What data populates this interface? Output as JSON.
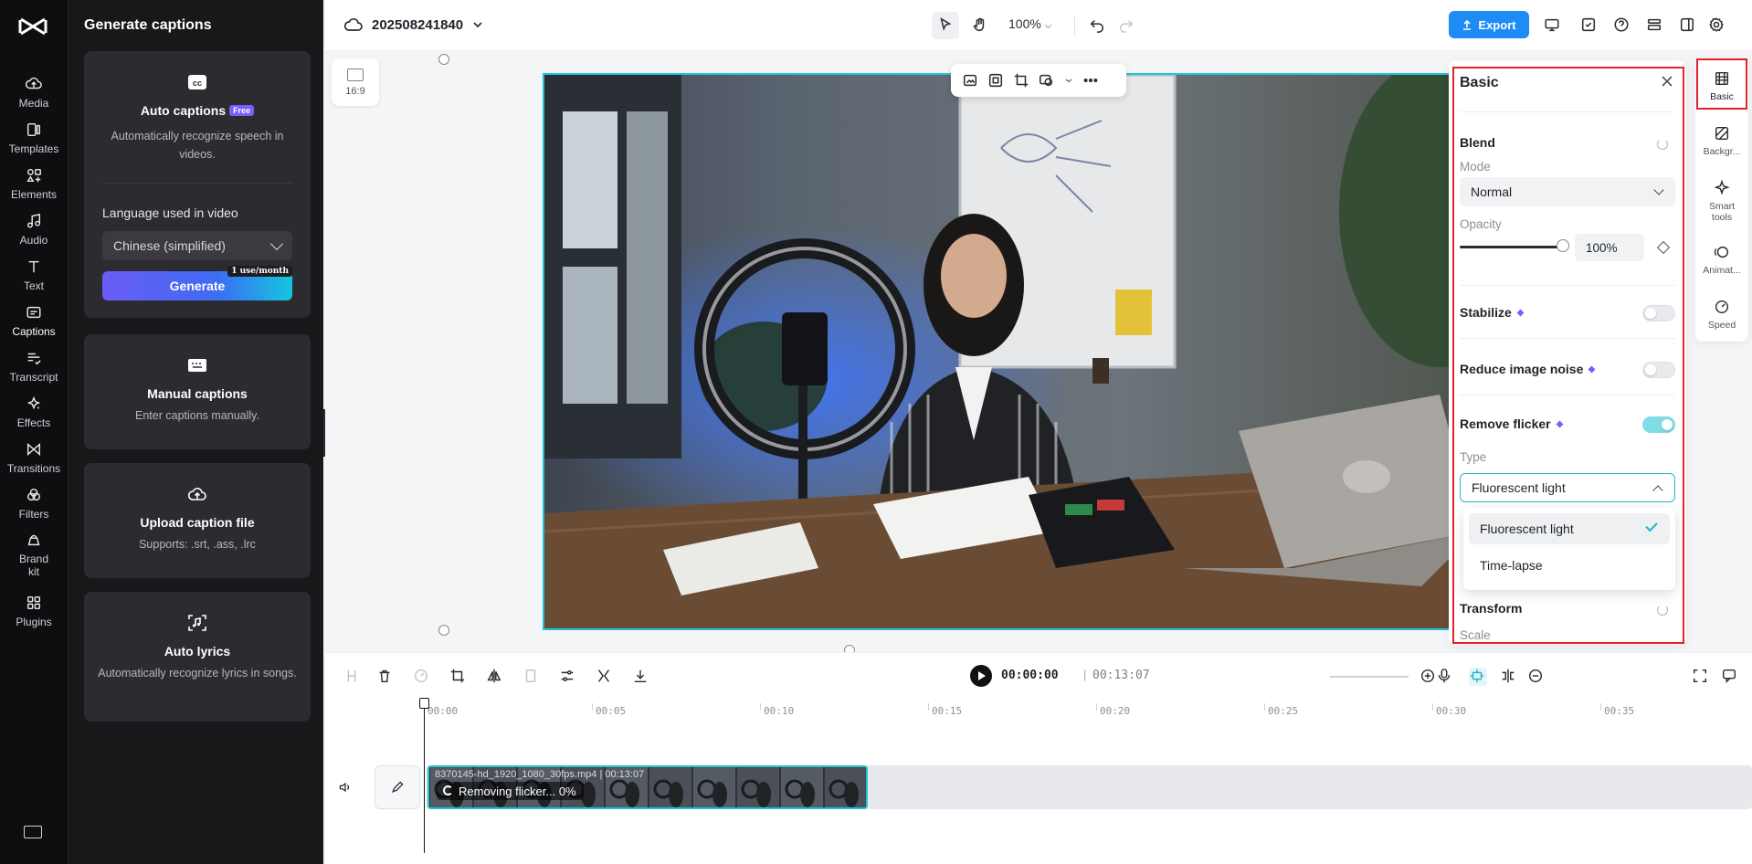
{
  "app": {
    "project_name": "202508241840",
    "zoom": "100%",
    "export_label": "Export"
  },
  "rail": {
    "items": [
      {
        "label": "Media",
        "icon": "cloud-upload-icon"
      },
      {
        "label": "Templates",
        "icon": "templates-icon"
      },
      {
        "label": "Elements",
        "icon": "elements-icon"
      },
      {
        "label": "Audio",
        "icon": "audio-icon"
      },
      {
        "label": "Text",
        "icon": "text-icon"
      },
      {
        "label": "Captions",
        "icon": "captions-icon",
        "active": true
      },
      {
        "label": "Transcript",
        "icon": "transcript-icon"
      },
      {
        "label": "Effects",
        "icon": "effects-icon"
      },
      {
        "label": "Transitions",
        "icon": "transitions-icon"
      },
      {
        "label": "Filters",
        "icon": "filters-icon"
      },
      {
        "label": "Brand kit",
        "icon": "brand-kit-icon"
      },
      {
        "label": "Plugins",
        "icon": "plugins-icon"
      }
    ]
  },
  "captions_panel": {
    "title": "Generate captions",
    "auto": {
      "title": "Auto captions",
      "badge": "Free",
      "desc": "Automatically recognize speech in videos.",
      "lang_label": "Language used in video",
      "lang_value": "Chinese (simplified)",
      "generate_label": "Generate",
      "usage_badge": "1 use/month"
    },
    "manual": {
      "title": "Manual captions",
      "desc": "Enter captions manually."
    },
    "upload": {
      "title": "Upload caption file",
      "desc": "Supports: .srt, .ass, .lrc"
    },
    "lyrics": {
      "title": "Auto lyrics",
      "desc": "Automatically recognize lyrics in songs."
    }
  },
  "canvas": {
    "ratio_label": "16:9"
  },
  "props": {
    "title": "Basic",
    "blend": {
      "title": "Blend",
      "mode_label": "Mode",
      "mode_value": "Normal",
      "opacity_label": "Opacity",
      "opacity_value": "100%",
      "opacity_level": 1.0
    },
    "stabilize": {
      "label": "Stabilize",
      "on": false
    },
    "reduce_noise": {
      "label": "Reduce image noise",
      "on": false
    },
    "remove_flicker": {
      "label": "Remove flicker",
      "on": true,
      "type_label": "Type",
      "type_value": "Fluorescent light",
      "options": [
        {
          "label": "Fluorescent light",
          "selected": true
        },
        {
          "label": "Time-lapse",
          "selected": false
        }
      ]
    },
    "transform": {
      "title": "Transform",
      "scale_label": "Scale"
    }
  },
  "right_tools": [
    {
      "label": "Basic",
      "icon": "basic-icon",
      "active": true
    },
    {
      "label": "Backgr...",
      "icon": "background-icon"
    },
    {
      "label": "Smart tools",
      "icon": "smart-tools-icon"
    },
    {
      "label": "Animat...",
      "icon": "animation-icon"
    },
    {
      "label": "Speed",
      "icon": "speed-icon"
    }
  ],
  "timeline": {
    "current_time": "00:00:00",
    "separator": "|",
    "total_time": "00:13:07",
    "ruler": [
      "00:00",
      "00:05",
      "00:10",
      "00:15",
      "00:20",
      "00:25",
      "00:30",
      "00:35"
    ],
    "clip": {
      "name": "8370145-hd_1920_1080_30fps.mp4",
      "duration": "00:13:07",
      "status": "Removing flicker... 0%"
    }
  }
}
